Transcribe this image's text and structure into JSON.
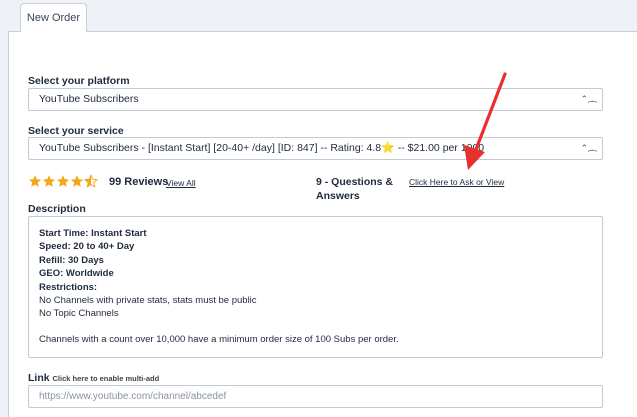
{
  "tabs": [
    {
      "label": "New Order"
    }
  ],
  "platform": {
    "label": "Select your platform",
    "value": "YouTube Subscribers"
  },
  "service": {
    "label": "Select your service",
    "value_before": "YouTube Subscribers - [Instant Start] [20-40+ /day] [ID: 847] -- Rating: 4.8",
    "value_after": " -- $21.00 per 1000"
  },
  "rating": {
    "stars": 4.5,
    "reviews_text": "99 Reviews",
    "view_all": "View All"
  },
  "qa": {
    "text": "9 - Questions & Answers",
    "ask_link": "Click Here to Ask or View"
  },
  "description": {
    "label": "Description",
    "lines": {
      "l1": "Start Time: Instant Start",
      "l2": "Speed: 20 to 40+ Day",
      "l3": "Refill: 30 Days",
      "l4": "GEO: Worldwide",
      "l5": "Restrictions:",
      "l6": "No Channels with private stats, stats must be public",
      "l7": "No Topic Channels",
      "l8": "Channels with a count over 10,000 have a minimum order size of 100 Subs per order."
    }
  },
  "link": {
    "label": "Link",
    "hint": "Click here to enable multi-add",
    "placeholder": "https://www.youtube.com/channel/abcedef"
  },
  "colors": {
    "star": "#f2a81d",
    "arrow": "#e8312f",
    "border": "#c4cad3"
  }
}
